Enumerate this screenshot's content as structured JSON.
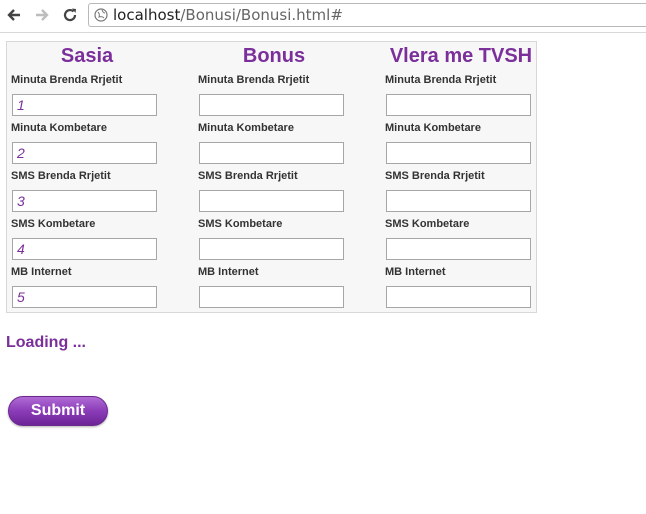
{
  "browser": {
    "url_host": "localhost",
    "url_path": "/Bonusi/Bonusi.html#"
  },
  "form": {
    "columns": [
      {
        "title": "Sasia",
        "fields": [
          {
            "label": "Minuta Brenda Rrjetit",
            "value": "1"
          },
          {
            "label": "Minuta Kombetare",
            "value": "2"
          },
          {
            "label": "SMS Brenda Rrjetit",
            "value": "3"
          },
          {
            "label": "SMS Kombetare",
            "value": "4"
          },
          {
            "label": "MB Internet",
            "value": "5"
          }
        ]
      },
      {
        "title": "Bonus",
        "fields": [
          {
            "label": "Minuta Brenda Rrjetit",
            "value": ""
          },
          {
            "label": "Minuta Kombetare",
            "value": ""
          },
          {
            "label": "SMS Brenda Rrjetit",
            "value": ""
          },
          {
            "label": "SMS Kombetare",
            "value": ""
          },
          {
            "label": "MB Internet",
            "value": ""
          }
        ]
      },
      {
        "title": "Vlera me TVSH",
        "fields": [
          {
            "label": "Minuta Brenda Rrjetit",
            "value": ""
          },
          {
            "label": "Minuta Kombetare",
            "value": ""
          },
          {
            "label": "SMS Brenda Rrjetit",
            "value": ""
          },
          {
            "label": "SMS Kombetare",
            "value": ""
          },
          {
            "label": "MB Internet",
            "value": ""
          }
        ]
      }
    ]
  },
  "status": {
    "loading_text": "Loading ..."
  },
  "actions": {
    "submit_label": "Submit"
  },
  "colors": {
    "accent": "#7a2f9a"
  }
}
